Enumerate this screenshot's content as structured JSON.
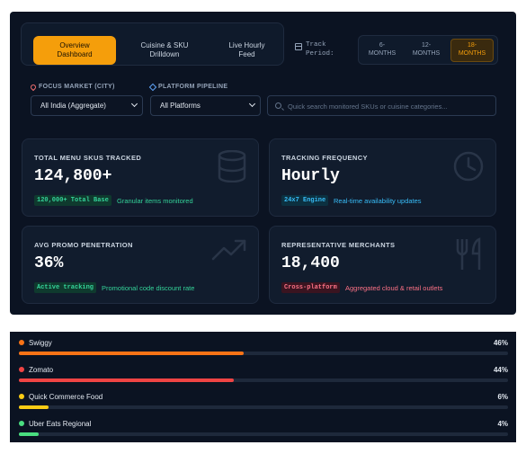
{
  "nav": {
    "tabs": [
      {
        "line1": "Overview",
        "line2": "Dashboard",
        "active": true
      },
      {
        "line1": "Cuisine & SKU",
        "line2": "Drilldown",
        "active": false
      },
      {
        "line1": "Live Hourly",
        "line2": "Feed",
        "active": false
      }
    ]
  },
  "track_period": {
    "label_line1": "Track",
    "label_line2": "Period:",
    "options": [
      {
        "line1": "6-",
        "line2": "MONTHS",
        "active": false
      },
      {
        "line1": "12-",
        "line2": "MONTHS",
        "active": false
      },
      {
        "line1": "18-",
        "line2": "MONTHS",
        "active": true
      }
    ]
  },
  "filters": {
    "market_label": "FOCUS MARKET (CITY)",
    "market_value": "All India (Aggregate)",
    "pipeline_label": "PLATFORM PIPELINE",
    "pipeline_value": "All Platforms",
    "search_placeholder": "Quick search monitored SKUs or cuisine categories..."
  },
  "cards": [
    {
      "title": "TOTAL MENU SKUS TRACKED",
      "value": "124,800+",
      "badge": "120,000+ Total Base",
      "note": "Granular items monitored",
      "accent": "#34d399",
      "icon": "database-icon"
    },
    {
      "title": "TRACKING FREQUENCY",
      "value": "Hourly",
      "badge": "24x7 Engine",
      "note": "Real-time availability updates",
      "accent": "#38bdf8",
      "icon": "clock-icon"
    },
    {
      "title": "AVG PROMO PENETRATION",
      "value": "36%",
      "badge": "Active tracking",
      "note": "Promotional code discount rate",
      "accent": "#34d399",
      "icon": "trend-up-icon"
    },
    {
      "title": "REPRESENTATIVE MERCHANTS",
      "value": "18,400",
      "badge": "Cross-platform",
      "note": "Aggregated cloud & retail outlets",
      "accent": "#fb7185",
      "icon": "utensils-icon"
    }
  ],
  "platform_share": [
    {
      "name": "Swiggy",
      "pct_label": "46%",
      "value": 46,
      "color": "#f97316"
    },
    {
      "name": "Zomato",
      "pct_label": "44%",
      "value": 44,
      "color": "#ef4444"
    },
    {
      "name": "Quick Commerce Food",
      "pct_label": "6%",
      "value": 6,
      "color": "#facc15"
    },
    {
      "name": "Uber Eats Regional",
      "pct_label": "4%",
      "value": 4,
      "color": "#4ade80"
    }
  ]
}
